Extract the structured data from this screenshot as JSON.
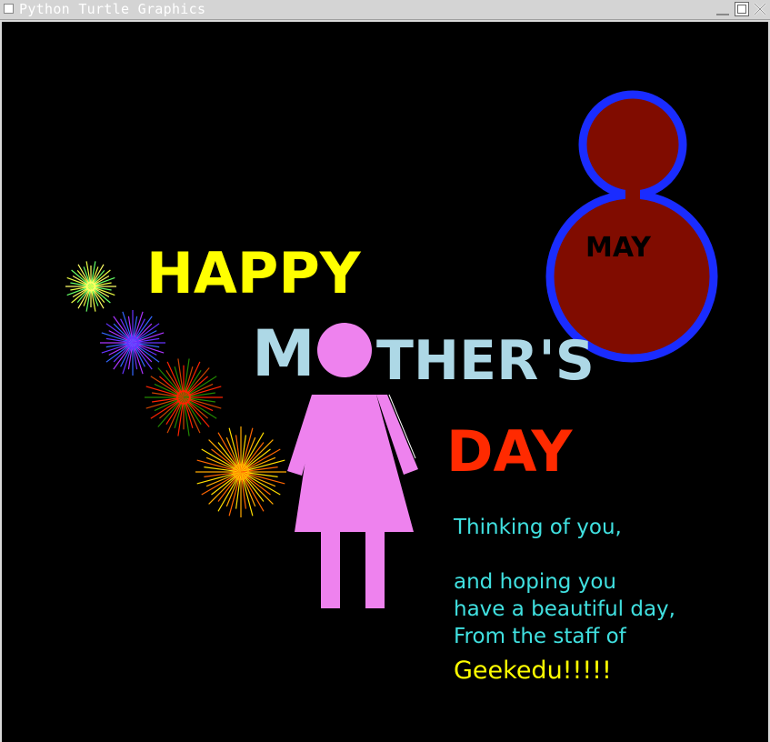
{
  "window": {
    "title": "Python Turtle Graphics"
  },
  "card": {
    "happy": "HAPPY",
    "mothers_m": "M",
    "mothers_rest": "THER'S",
    "day": "DAY",
    "may": "MAY",
    "message_lines": [
      "Thinking of you,",
      "and hoping you",
      "have a beautiful day,",
      "From the staff of"
    ],
    "signature": "Geekedu!!!!!"
  },
  "colors": {
    "background": "#000000",
    "happy": "#ffff00",
    "mothers": "#add8e6",
    "day": "#ff2a00",
    "figure": "#ee82ee",
    "eight_fill": "#800c00",
    "eight_outline": "#1a2cff",
    "message": "#40e0e0",
    "signature": "#ffff00"
  },
  "fireworks": [
    {
      "name": "yellow-green-firework",
      "colors": [
        "#ffff66",
        "#66ff66",
        "#eeff44"
      ]
    },
    {
      "name": "purple-blue-firework",
      "colors": [
        "#6633ff",
        "#3366ff",
        "#aa33ff"
      ]
    },
    {
      "name": "red-green-firework",
      "colors": [
        "#ff2200",
        "#228800",
        "#cc4400"
      ]
    },
    {
      "name": "orange-yellow-firework",
      "colors": [
        "#ffaa00",
        "#ffdd00",
        "#ff6600"
      ]
    }
  ]
}
